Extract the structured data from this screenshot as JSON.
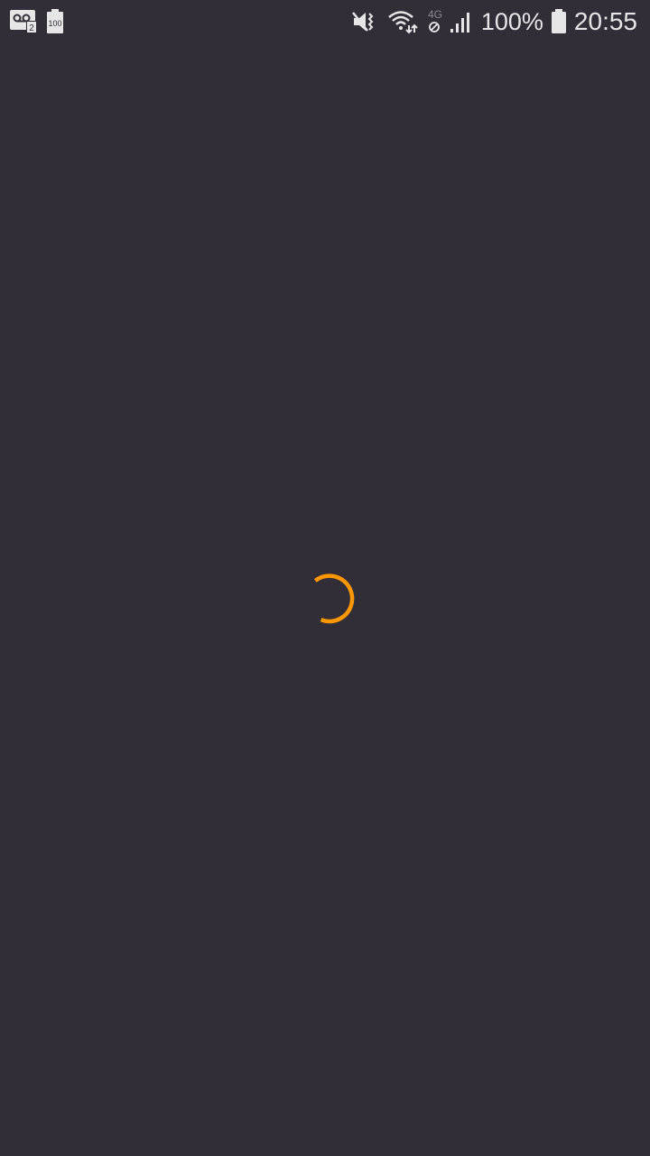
{
  "status_bar": {
    "left_icons": [
      "voicemail-icon",
      "battery-saver-icon"
    ],
    "voicemail_count": "2",
    "battery_saver_label": "100",
    "right_icons": [
      "vibrate-mute-icon",
      "wifi-icon",
      "mobile-data-4g-icon",
      "signal-icon",
      "battery-icon"
    ],
    "network_label": "4G",
    "battery_percent": "100%",
    "time": "20:55"
  },
  "loading": {
    "icon": "loading-spinner-icon",
    "color": "#ff9800"
  },
  "colors": {
    "background": "#312e38",
    "status_text": "#e6e6e6",
    "accent": "#ff9800"
  }
}
